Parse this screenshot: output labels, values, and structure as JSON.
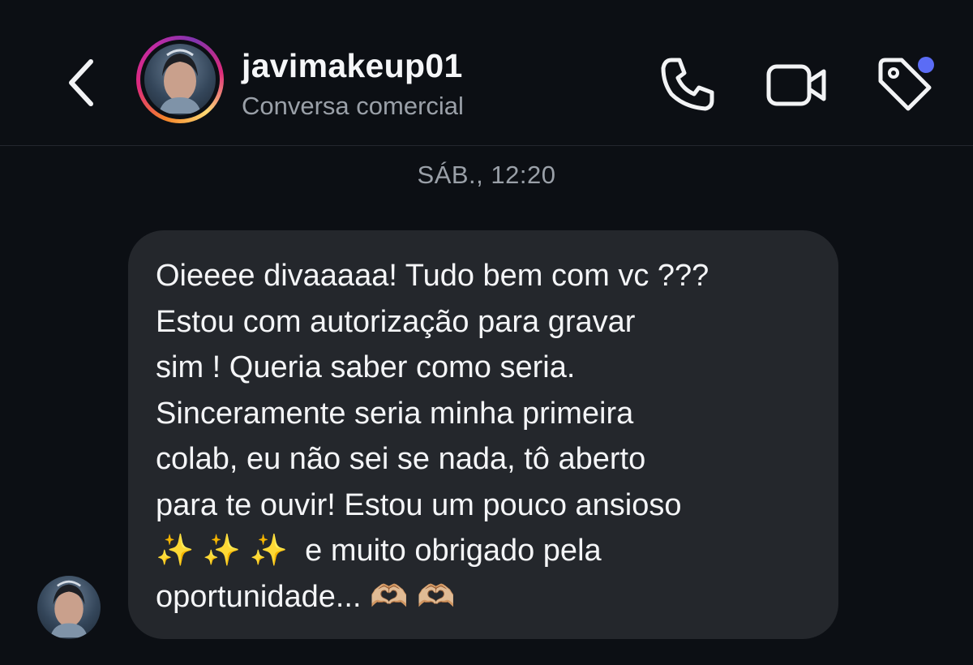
{
  "header": {
    "username": "javimakeup01",
    "subtitle": "Conversa comercial",
    "icons": {
      "back": "chevron-left-icon",
      "call": "phone-icon",
      "video": "video-camera-icon",
      "tag": "tag-icon"
    },
    "notification_dot_color": "#5b6cf5"
  },
  "conversation": {
    "timestamp": "SÁB., 12:20",
    "messages": [
      {
        "text": "Oieeee divaaaaa! Tudo bem com vc ???\nEstou com autorização para gravar\nsim ! Queria saber como seria.\nSinceramente seria minha primeira\ncolab, eu não sei se nada, tô aberto\npara te ouvir! Estou um pouco ansioso\n✨ ✨ ✨  e muito obrigado pela\noportunidade... 🫶🏼 🫶🏼"
      }
    ]
  },
  "colors": {
    "background": "#0c0f14",
    "bubble": "#24272c",
    "secondary_text": "#9aa0a8"
  }
}
